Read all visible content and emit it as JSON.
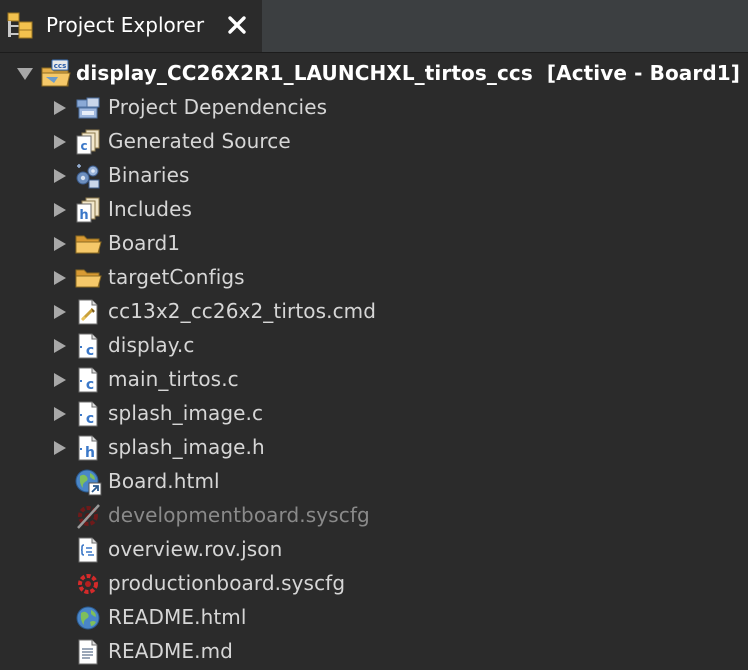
{
  "view": {
    "tab_title": "Project Explorer",
    "tab_icon": "project-explorer-icon",
    "close_icon": "close-icon"
  },
  "project": {
    "name": "display_CC26X2R1_LAUNCHXL_tirtos_ccs",
    "status": "[Active - Board1]",
    "expanded": true
  },
  "items": [
    {
      "label": "Project Dependencies",
      "icon": "project-dependencies-icon",
      "expandable": true
    },
    {
      "label": "Generated Source",
      "icon": "generated-source-icon",
      "expandable": true
    },
    {
      "label": "Binaries",
      "icon": "binaries-icon",
      "expandable": true
    },
    {
      "label": "Includes",
      "icon": "includes-icon",
      "expandable": true
    },
    {
      "label": "Board1",
      "icon": "folder-icon",
      "expandable": true
    },
    {
      "label": "targetConfigs",
      "icon": "folder-icon",
      "expandable": true
    },
    {
      "label": "cc13x2_cc26x2_tirtos.cmd",
      "icon": "cmd-file-icon",
      "expandable": true
    },
    {
      "label": "display.c",
      "icon": "c-file-icon",
      "expandable": true
    },
    {
      "label": "main_tirtos.c",
      "icon": "c-file-icon",
      "expandable": true
    },
    {
      "label": "splash_image.c",
      "icon": "c-file-icon",
      "expandable": true
    },
    {
      "label": "splash_image.h",
      "icon": "h-file-icon",
      "expandable": true
    },
    {
      "label": "Board.html",
      "icon": "html-link-icon",
      "expandable": false
    },
    {
      "label": "developmentboard.syscfg",
      "icon": "syscfg-disabled-icon",
      "expandable": false,
      "dimmed": true
    },
    {
      "label": "overview.rov.json",
      "icon": "json-file-icon",
      "expandable": false
    },
    {
      "label": "productionboard.syscfg",
      "icon": "syscfg-icon",
      "expandable": false
    },
    {
      "label": "README.html",
      "icon": "html-file-icon",
      "expandable": false
    },
    {
      "label": "README.md",
      "icon": "text-file-icon",
      "expandable": false
    }
  ],
  "colors": {
    "background": "#2b2b2b",
    "text": "#d6d6d6",
    "dimmed_text": "#8a8a8a",
    "folder": "#e8b04a",
    "c_file_blue": "#3b78c8"
  }
}
